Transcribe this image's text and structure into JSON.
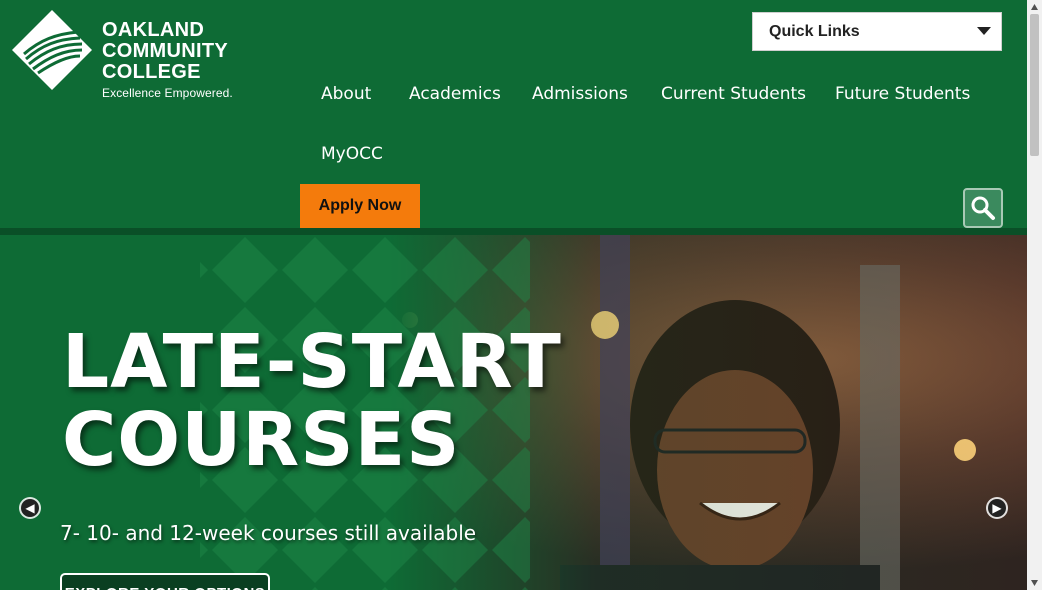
{
  "logo": {
    "lines": [
      "OAKLAND",
      "COMMUNITY",
      "COLLEGE"
    ],
    "tagline": "Excellence Empowered."
  },
  "quick_links": {
    "label": "Quick Links"
  },
  "nav": {
    "items": [
      "About",
      "Academics",
      "Admissions",
      "Current Students",
      "Future Students",
      "MyOCC"
    ]
  },
  "apply_now": "Apply Now",
  "hero": {
    "title_line1": "LATE-START",
    "title_line2": "COURSES",
    "subtitle": "7- 10- and 12-week courses still available",
    "cta": "EXPLORE YOUR OPTIONS"
  },
  "colors": {
    "brand_green": "#0e6b35",
    "accent_orange": "#f47b0c"
  },
  "icons": [
    "search-icon",
    "chevron-left-icon",
    "chevron-right-icon",
    "chevron-down-icon"
  ]
}
